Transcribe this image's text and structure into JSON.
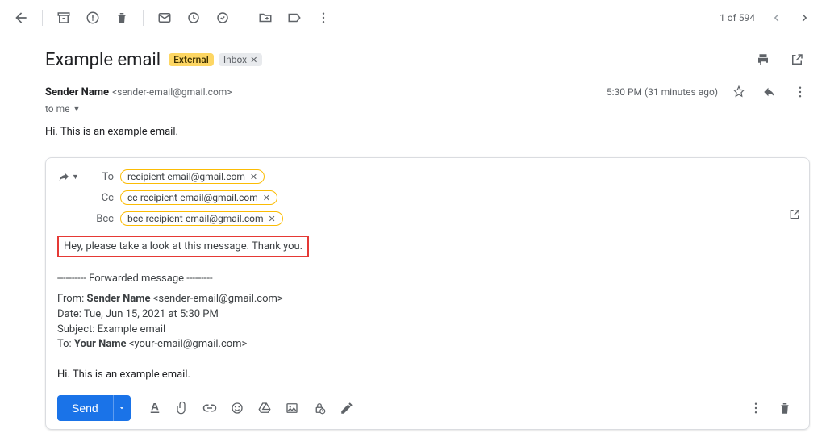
{
  "toolbar": {
    "counter": "1 of 594"
  },
  "subject": {
    "text": "Example email",
    "badge_external": "External",
    "badge_inbox": "Inbox"
  },
  "sender": {
    "name": "Sender Name",
    "email": "<sender-email@gmail.com>",
    "timestamp": "5:30 PM (31 minutes ago)",
    "to_line": "to me"
  },
  "body": "Hi. This is an example email.",
  "compose": {
    "labels": {
      "to": "To",
      "cc": "Cc",
      "bcc": "Bcc"
    },
    "recipients": {
      "to": "recipient-email@gmail.com",
      "cc": "cc-recipient-email@gmail.com",
      "bcc": "bcc-recipient-email@gmail.com"
    },
    "highlighted_note": "Hey, please take a look at this message. Thank you.",
    "fwd_header_line": "---------- Forwarded message ---------",
    "fwd": {
      "from_label": "From: ",
      "from_name": "Sender Name",
      "from_email": " <sender-email@gmail.com>",
      "date_line": "Date: Tue, Jun 15, 2021 at 5:30 PM",
      "subject_line": "Subject: Example email",
      "to_label": "To: ",
      "to_name": "Your Name",
      "to_email": " <your-email@gmail.com>"
    },
    "fwd_body": "Hi. This is an example email.",
    "send_label": "Send"
  }
}
